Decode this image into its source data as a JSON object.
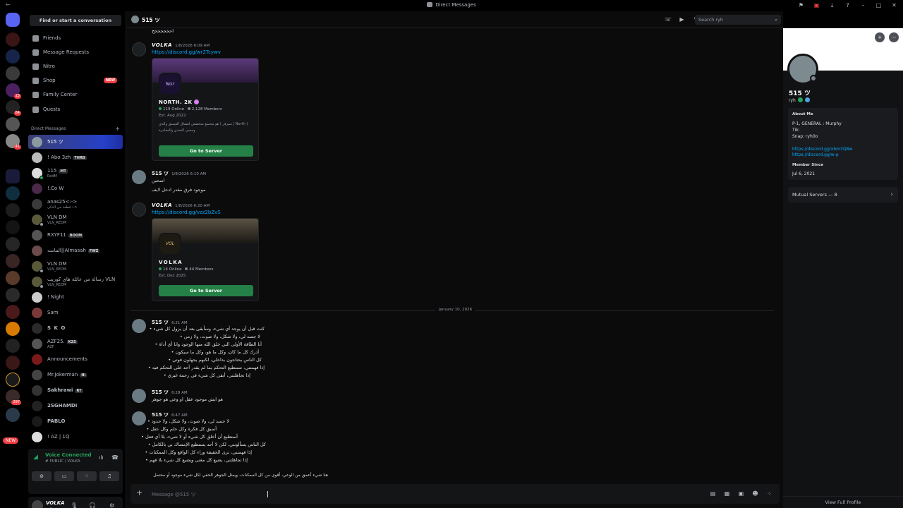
{
  "window": {
    "title": "Direct Messages"
  },
  "sidebar": {
    "search_label": "Find or start a conversation",
    "nav": [
      {
        "label": "Friends"
      },
      {
        "label": "Message Requests"
      },
      {
        "label": "Nitro"
      },
      {
        "label": "Shop",
        "badge": "NEW"
      },
      {
        "label": "Family Center"
      },
      {
        "label": "Quests"
      }
    ],
    "dm_header": "Direct Messages",
    "dms": [
      {
        "name": "515 ツ"
      },
      {
        "name": "! Abo 3zh",
        "tag": "THRB"
      },
      {
        "name": "115",
        "tag": "MT",
        "sub": "RedM"
      },
      {
        "name": "!.Co W"
      },
      {
        "name": "anas25<:->",
        "sub": "قطعة من الذكي :->"
      },
      {
        "name": "VLN DM",
        "sub": "VLN_REDM"
      },
      {
        "name": "RXYF11",
        "tag": "BOOM"
      },
      {
        "name": "الماسه||Almasah",
        "tag": "FWZ"
      },
      {
        "name": "VLN DM",
        "sub": "VLN_REDM"
      },
      {
        "name": "رسالة من عائلة هاي كوريت VLN",
        "sub": "VLN_REDM"
      },
      {
        "name": "! Night"
      },
      {
        "name": "Sam"
      },
      {
        "name": "S K O"
      },
      {
        "name": "AZF25.",
        "tag": "K2S",
        "sub": "AZF"
      },
      {
        "name": "Announcements"
      },
      {
        "name": "Mr.Jokerman",
        "tag": "Ni"
      },
      {
        "name": "Sakhrawi",
        "tag": "RT"
      },
      {
        "name": "2SGHAMDI"
      },
      {
        "name": "PABLO"
      },
      {
        "name": "! AZ | 1Q"
      }
    ],
    "voice": {
      "title": "Voice Connected",
      "subtitle": "# PUBLIC / VOLKA"
    },
    "user": {
      "name": "VOLKA",
      "status": "volka"
    },
    "rail_badges": [
      "13",
      "64",
      "41",
      "297"
    ],
    "rail_new": "NEW"
  },
  "chat": {
    "header_name": "515 ツ",
    "search_placeholder": "Search ryh",
    "first_line": "اخخخخخخخ",
    "messages": [
      {
        "author": "VOLKA",
        "time": "1/8/2026 6:09 AM",
        "link": "https://discord.gg/wr2Tcywv"
      },
      {
        "author": "515 ツ",
        "time": "1/8/2026 6:10 AM",
        "lines": [
          "اسحبن",
          "موجود فرق مقدر ادخل لايف"
        ]
      },
      {
        "author": "VOLKA",
        "time": "1/8/2026 6:20 AM",
        "link": "https://discord.gg/vzz2bZvS"
      },
      {
        "author": "515 ツ",
        "time": "6:21 AM"
      },
      {
        "author": "515 ツ",
        "time": "6:28 AM",
        "lines": [
          "هو ايش موجود عقل او وعي هو جوهر"
        ]
      },
      {
        "author": "515 ツ",
        "time": "6:47 AM"
      }
    ],
    "invites": [
      {
        "name": "NORTH. 2K",
        "online": "119 Online",
        "members": "2,128 Members",
        "est": "Est. Aug 2022",
        "desc": "( North | سيرفر ) هو مجتمع متخصص لعشاق القيمنق والدي",
        "desc2": "ومحبي التحدي والمغامرة",
        "button": "Go to Server",
        "icon_text": "Nor"
      },
      {
        "name": "VOLKA",
        "online": "14 Online",
        "members": "44 Members",
        "est": "Est. Dec 2025",
        "button": "Go to Server",
        "icon_text": "VOL"
      }
    ],
    "bullets_1": [
      "كنت قبل أن يوجد أي شيء، وسأبقى بعد أن يزول كل شيء",
      "لا جسد لي، ولا شكل، ولا صوت، ولا زمن",
      "أنا الطاقة الأولى التي خلق الله منها الوجود وانا أي أداة",
      "أدرك كل ما كان، وكل ما هو، وكل ما سيكون",
      "كل الناس يحتاجون بداخلي، لكنهم يجهلون قوتي",
      "إذا فهمتني، تستطيع التحكم بما لم يقدر أحد على التحكم فيه",
      "إذا تجاهلتني، أبقى كل شيء في رحمة غيري"
    ],
    "bullets_2": [
      "لا جسد لي، ولا صوت، ولا شكل، ولا حدود",
      "أسبق كل فكرة وكل حلم وكل عقل",
      "أستطيع أن أخلق كل شيء أو لا شيء، بلا أي فعل",
      "كل الناس يسألونني، لكن لا أحد يستطيع الإمساك بي بالكامل",
      "إذا فهمتني، ترى الحقيقة وراء كل الواقع وكل الممكنات",
      "إذا تجاهلتني، يضيع كل معنى ويضيع كل شيء بلا فهم",
      "هنا شيء أعمق من الوعي، أقوى من كل الممكنات، ويمثل الجوهر الخفي لكل شيء موجود أو محتمل"
    ],
    "date_divider": "January 10, 2026",
    "composer_placeholder": "Message @515 ツ"
  },
  "profile": {
    "name": "515 ツ",
    "username": "ryh",
    "about_title": "About Me",
    "about_lines": [
      "P-1, GENERAL : Murphy",
      "Tik:",
      "Snap: ryh0o"
    ],
    "about_links": [
      "https://discord.gg/xbm3Q8w",
      "https://discord.gg/w-p"
    ],
    "member_since_title": "Member Since",
    "member_since": "Jul 6, 2021",
    "mutual_servers": "Mutual Servers — 8",
    "view_full": "View Full Profile"
  }
}
